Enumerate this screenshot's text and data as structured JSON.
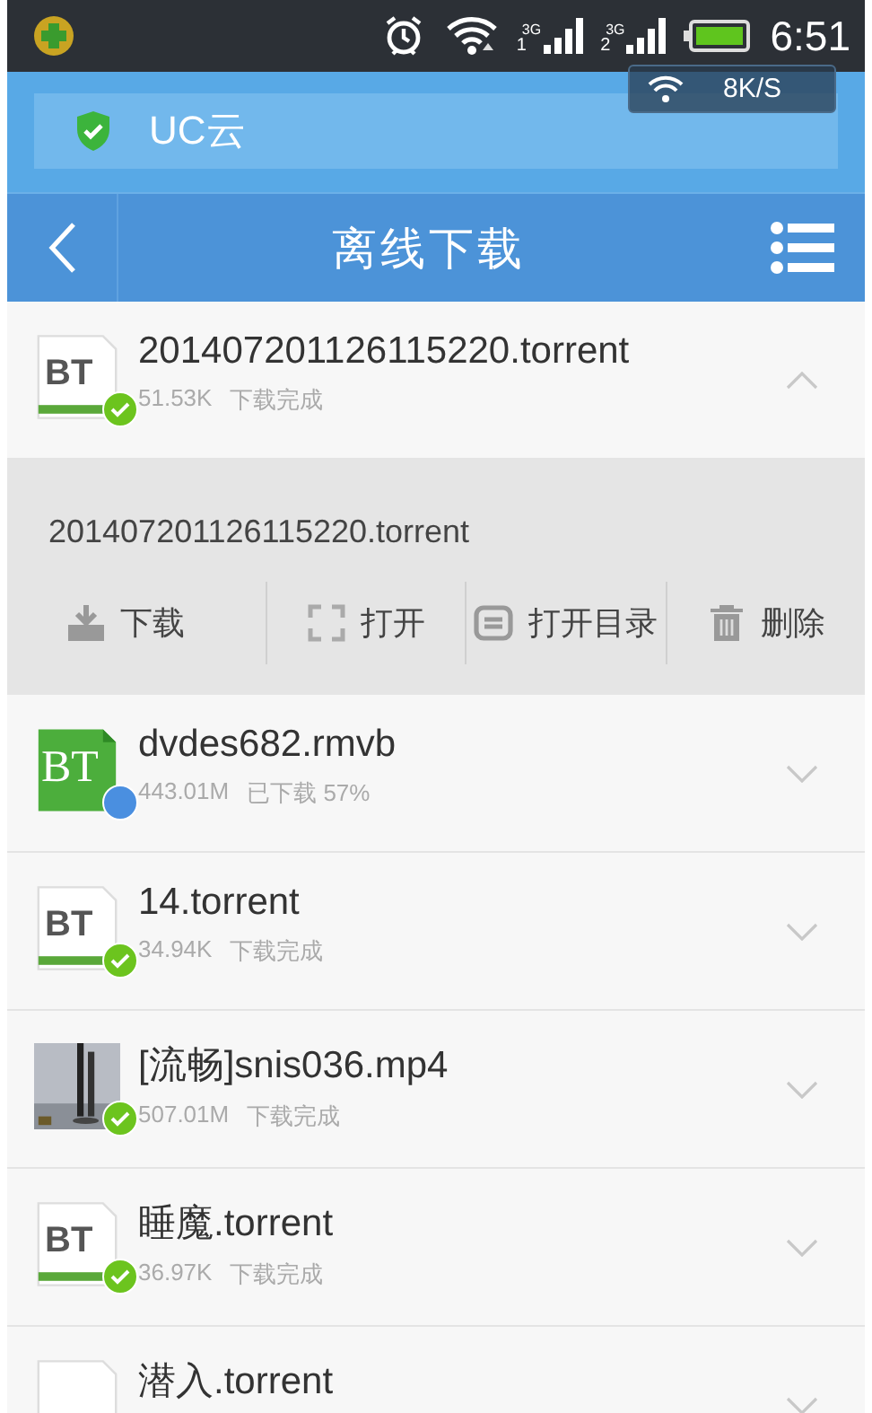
{
  "status_bar": {
    "time": "6:51",
    "signals": [
      {
        "sim": "1",
        "network": "3G"
      },
      {
        "sim": "2",
        "network": "3G"
      }
    ]
  },
  "speed_overlay": {
    "speed": "8K/S"
  },
  "banner": {
    "label": "UC云"
  },
  "header": {
    "title": "离线下载"
  },
  "items": [
    {
      "name": "201407201126115220.torrent",
      "size": "51.53K",
      "status": "下载完成",
      "kind": "bt",
      "icon_label": "BT",
      "downloaded": true,
      "expanded": true,
      "detail": {
        "name": "201407201126115220.torrent",
        "actions": [
          {
            "kind": "download",
            "label": "下载"
          },
          {
            "kind": "open",
            "label": "打开"
          },
          {
            "kind": "folder",
            "label": "打开目录"
          },
          {
            "kind": "delete",
            "label": "删除"
          }
        ]
      }
    },
    {
      "name": "dvdes682.rmvb",
      "size": "443.01M",
      "status": "已下载 57%",
      "kind": "torrent",
      "icon_label": "BT",
      "downloaded": false,
      "expanded": false
    },
    {
      "name": "14.torrent",
      "size": "34.94K",
      "status": "下载完成",
      "kind": "bt",
      "icon_label": "BT",
      "downloaded": true,
      "expanded": false
    },
    {
      "name": "[流畅]snis036.mp4",
      "size": "507.01M",
      "status": "下载完成",
      "kind": "video",
      "downloaded": true,
      "expanded": false
    },
    {
      "name": "睡魔.torrent",
      "size": "36.97K",
      "status": "下载完成",
      "kind": "bt",
      "icon_label": "BT",
      "downloaded": true,
      "expanded": false
    },
    {
      "name": "潜入.torrent",
      "kind": "bt",
      "expanded": false
    }
  ]
}
